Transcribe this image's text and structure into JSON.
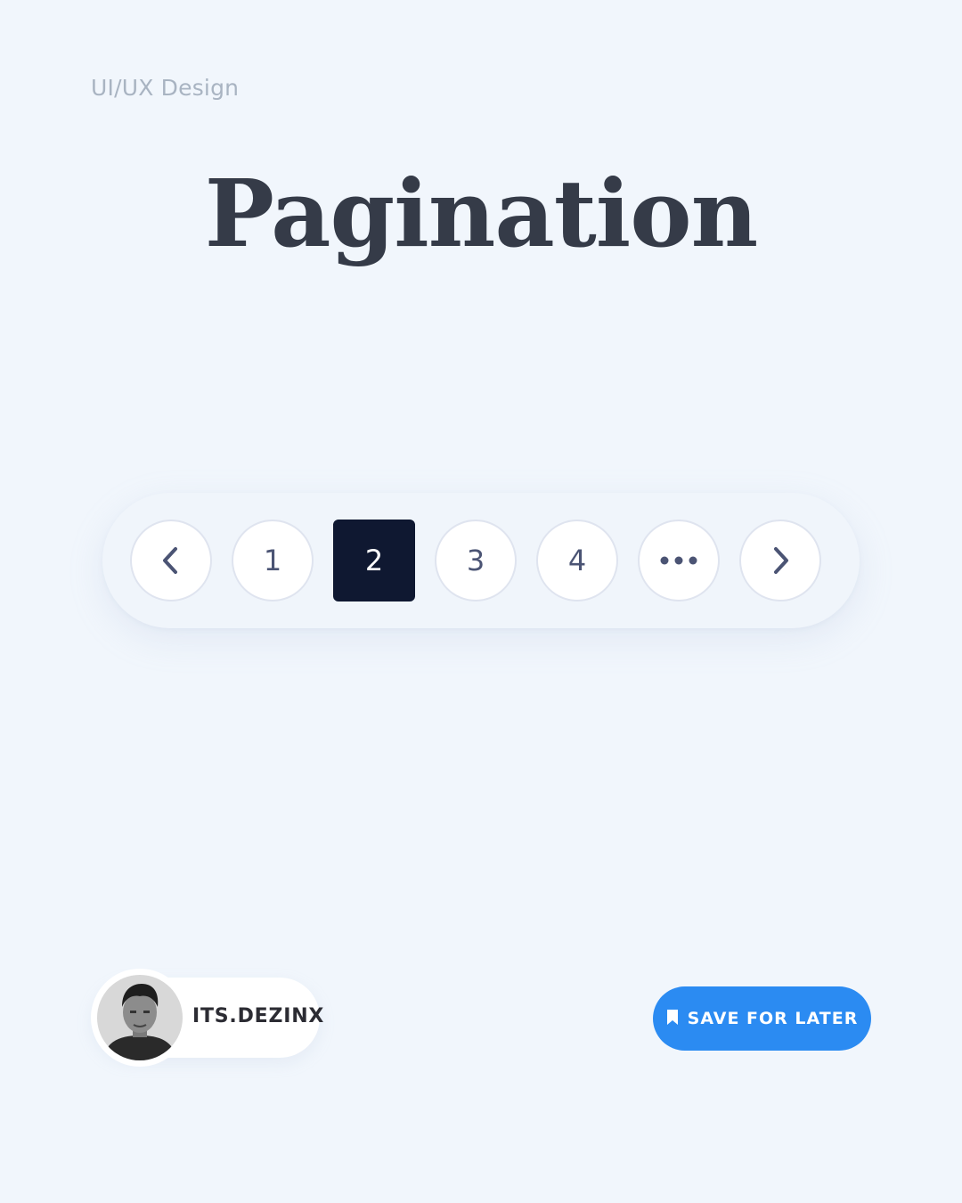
{
  "header": {
    "category": "UI/UX Design",
    "title": "Pagination"
  },
  "pagination": {
    "prev_icon": "chevron-left-icon",
    "next_icon": "chevron-right-icon",
    "more_icon": "ellipsis-icon",
    "pages": [
      "1",
      "2",
      "3",
      "4"
    ],
    "active_page": "2",
    "active_color": "#0f1831"
  },
  "author": {
    "name": "ITS.DEZINX",
    "avatar_icon": "avatar"
  },
  "save": {
    "label": "SAVE FOR LATER",
    "icon": "bookmark-icon",
    "color": "#2b8bf2"
  }
}
